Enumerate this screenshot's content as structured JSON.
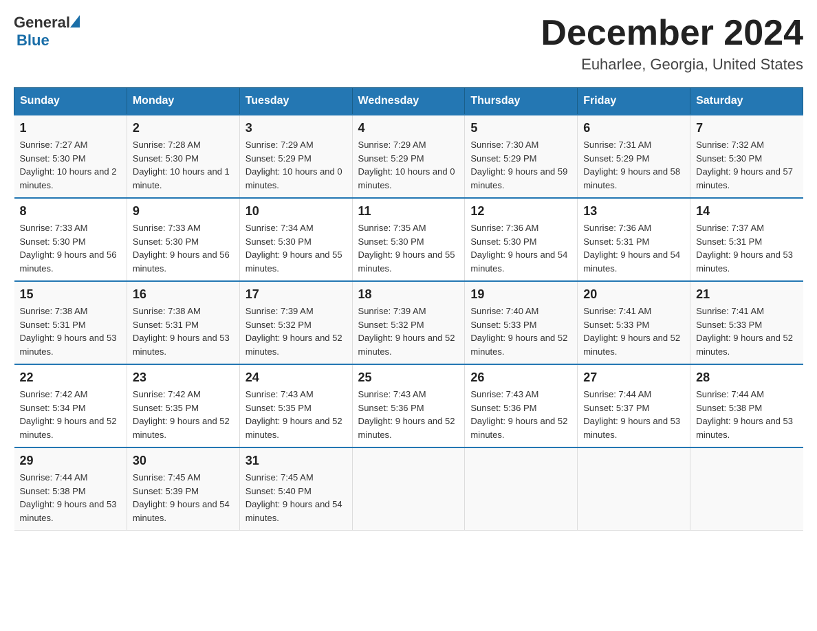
{
  "header": {
    "logo_general": "General",
    "logo_blue": "Blue",
    "month_title": "December 2024",
    "location": "Euharlee, Georgia, United States"
  },
  "weekdays": [
    "Sunday",
    "Monday",
    "Tuesday",
    "Wednesday",
    "Thursday",
    "Friday",
    "Saturday"
  ],
  "weeks": [
    [
      {
        "day": "1",
        "sunrise": "7:27 AM",
        "sunset": "5:30 PM",
        "daylight": "10 hours and 2 minutes."
      },
      {
        "day": "2",
        "sunrise": "7:28 AM",
        "sunset": "5:30 PM",
        "daylight": "10 hours and 1 minute."
      },
      {
        "day": "3",
        "sunrise": "7:29 AM",
        "sunset": "5:29 PM",
        "daylight": "10 hours and 0 minutes."
      },
      {
        "day": "4",
        "sunrise": "7:29 AM",
        "sunset": "5:29 PM",
        "daylight": "10 hours and 0 minutes."
      },
      {
        "day": "5",
        "sunrise": "7:30 AM",
        "sunset": "5:29 PM",
        "daylight": "9 hours and 59 minutes."
      },
      {
        "day": "6",
        "sunrise": "7:31 AM",
        "sunset": "5:29 PM",
        "daylight": "9 hours and 58 minutes."
      },
      {
        "day": "7",
        "sunrise": "7:32 AM",
        "sunset": "5:30 PM",
        "daylight": "9 hours and 57 minutes."
      }
    ],
    [
      {
        "day": "8",
        "sunrise": "7:33 AM",
        "sunset": "5:30 PM",
        "daylight": "9 hours and 56 minutes."
      },
      {
        "day": "9",
        "sunrise": "7:33 AM",
        "sunset": "5:30 PM",
        "daylight": "9 hours and 56 minutes."
      },
      {
        "day": "10",
        "sunrise": "7:34 AM",
        "sunset": "5:30 PM",
        "daylight": "9 hours and 55 minutes."
      },
      {
        "day": "11",
        "sunrise": "7:35 AM",
        "sunset": "5:30 PM",
        "daylight": "9 hours and 55 minutes."
      },
      {
        "day": "12",
        "sunrise": "7:36 AM",
        "sunset": "5:30 PM",
        "daylight": "9 hours and 54 minutes."
      },
      {
        "day": "13",
        "sunrise": "7:36 AM",
        "sunset": "5:31 PM",
        "daylight": "9 hours and 54 minutes."
      },
      {
        "day": "14",
        "sunrise": "7:37 AM",
        "sunset": "5:31 PM",
        "daylight": "9 hours and 53 minutes."
      }
    ],
    [
      {
        "day": "15",
        "sunrise": "7:38 AM",
        "sunset": "5:31 PM",
        "daylight": "9 hours and 53 minutes."
      },
      {
        "day": "16",
        "sunrise": "7:38 AM",
        "sunset": "5:31 PM",
        "daylight": "9 hours and 53 minutes."
      },
      {
        "day": "17",
        "sunrise": "7:39 AM",
        "sunset": "5:32 PM",
        "daylight": "9 hours and 52 minutes."
      },
      {
        "day": "18",
        "sunrise": "7:39 AM",
        "sunset": "5:32 PM",
        "daylight": "9 hours and 52 minutes."
      },
      {
        "day": "19",
        "sunrise": "7:40 AM",
        "sunset": "5:33 PM",
        "daylight": "9 hours and 52 minutes."
      },
      {
        "day": "20",
        "sunrise": "7:41 AM",
        "sunset": "5:33 PM",
        "daylight": "9 hours and 52 minutes."
      },
      {
        "day": "21",
        "sunrise": "7:41 AM",
        "sunset": "5:33 PM",
        "daylight": "9 hours and 52 minutes."
      }
    ],
    [
      {
        "day": "22",
        "sunrise": "7:42 AM",
        "sunset": "5:34 PM",
        "daylight": "9 hours and 52 minutes."
      },
      {
        "day": "23",
        "sunrise": "7:42 AM",
        "sunset": "5:35 PM",
        "daylight": "9 hours and 52 minutes."
      },
      {
        "day": "24",
        "sunrise": "7:43 AM",
        "sunset": "5:35 PM",
        "daylight": "9 hours and 52 minutes."
      },
      {
        "day": "25",
        "sunrise": "7:43 AM",
        "sunset": "5:36 PM",
        "daylight": "9 hours and 52 minutes."
      },
      {
        "day": "26",
        "sunrise": "7:43 AM",
        "sunset": "5:36 PM",
        "daylight": "9 hours and 52 minutes."
      },
      {
        "day": "27",
        "sunrise": "7:44 AM",
        "sunset": "5:37 PM",
        "daylight": "9 hours and 53 minutes."
      },
      {
        "day": "28",
        "sunrise": "7:44 AM",
        "sunset": "5:38 PM",
        "daylight": "9 hours and 53 minutes."
      }
    ],
    [
      {
        "day": "29",
        "sunrise": "7:44 AM",
        "sunset": "5:38 PM",
        "daylight": "9 hours and 53 minutes."
      },
      {
        "day": "30",
        "sunrise": "7:45 AM",
        "sunset": "5:39 PM",
        "daylight": "9 hours and 54 minutes."
      },
      {
        "day": "31",
        "sunrise": "7:45 AM",
        "sunset": "5:40 PM",
        "daylight": "9 hours and 54 minutes."
      },
      null,
      null,
      null,
      null
    ]
  ],
  "labels": {
    "sunrise": "Sunrise:",
    "sunset": "Sunset:",
    "daylight": "Daylight:"
  }
}
